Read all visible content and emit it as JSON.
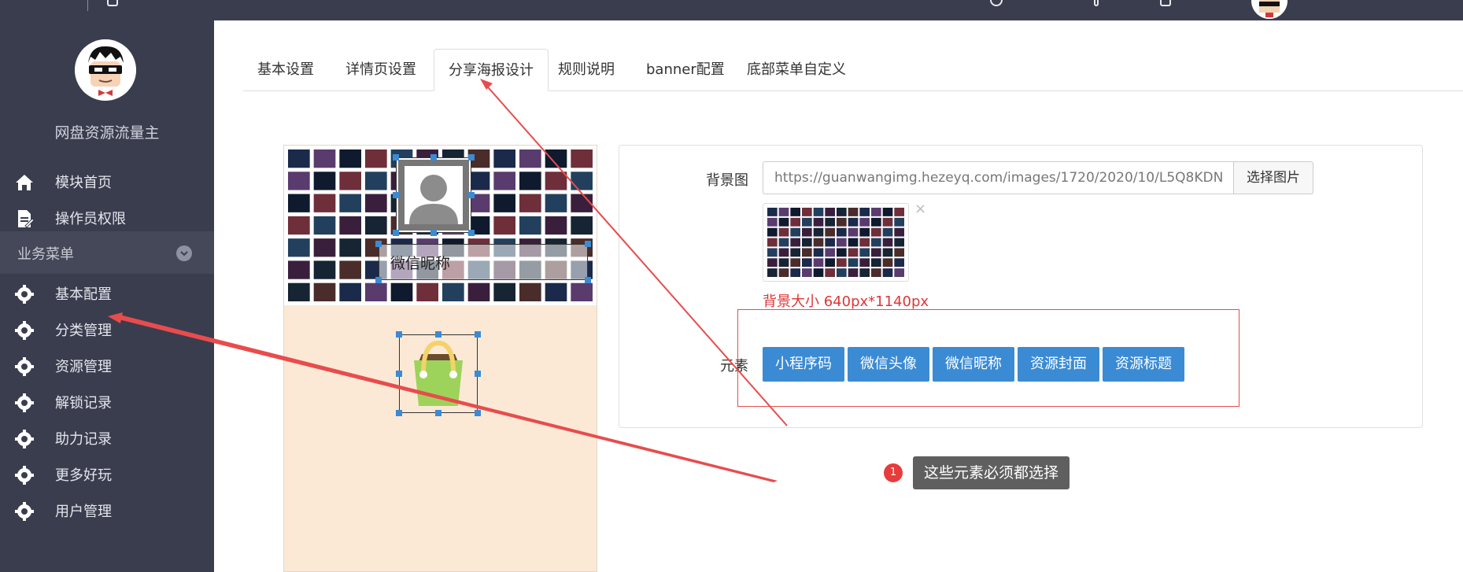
{
  "sidebar": {
    "profile_name": "网盘资源流量主",
    "top_items": [
      {
        "label": "模块首页",
        "icon": "home-icon"
      },
      {
        "label": "操作员权限",
        "icon": "document-edit-icon"
      }
    ],
    "section": {
      "label": "业务菜单",
      "icon": "chevron-down-icon"
    },
    "business_items": [
      {
        "label": "基本配置",
        "icon": "gear-icon"
      },
      {
        "label": "分类管理",
        "icon": "gear-icon"
      },
      {
        "label": "资源管理",
        "icon": "gear-icon"
      },
      {
        "label": "解锁记录",
        "icon": "gear-icon"
      },
      {
        "label": "助力记录",
        "icon": "gear-icon"
      },
      {
        "label": "更多好玩",
        "icon": "gear-icon"
      },
      {
        "label": "用户管理",
        "icon": "gear-icon"
      }
    ]
  },
  "tabs": [
    {
      "label": "基本设置"
    },
    {
      "label": "详情页设置"
    },
    {
      "label": "分享海报设计",
      "active": true
    },
    {
      "label": "规则说明"
    },
    {
      "label": "banner配置"
    },
    {
      "label": "底部菜单自定义"
    }
  ],
  "poster": {
    "nickname_element_text": "微信昵称",
    "avatar_icon": "user-avatar-icon",
    "qrcode_icon": "shopping-bag-icon"
  },
  "form": {
    "background_label": "背景图",
    "background_url": "https://guanwangimg.hezeyq.com/images/1720/2020/10/L5Q8KDN",
    "pick_image_button": "选择图片",
    "remove_icon": "close-icon",
    "size_hint": "背景大小 640px*1140px",
    "elements_label": "元素",
    "element_buttons": [
      {
        "label": "小程序码"
      },
      {
        "label": "微信头像"
      },
      {
        "label": "微信昵称"
      },
      {
        "label": "资源封面"
      },
      {
        "label": "资源标题"
      }
    ]
  },
  "callout": {
    "badge": "1",
    "text": "这些元素必须都选择"
  },
  "colors": {
    "sidebar_bg": "#3a3d4e",
    "primary_button": "#3b8bd4",
    "annotation_red": "#e84c4c",
    "poster_bg": "#fbe9d6"
  }
}
